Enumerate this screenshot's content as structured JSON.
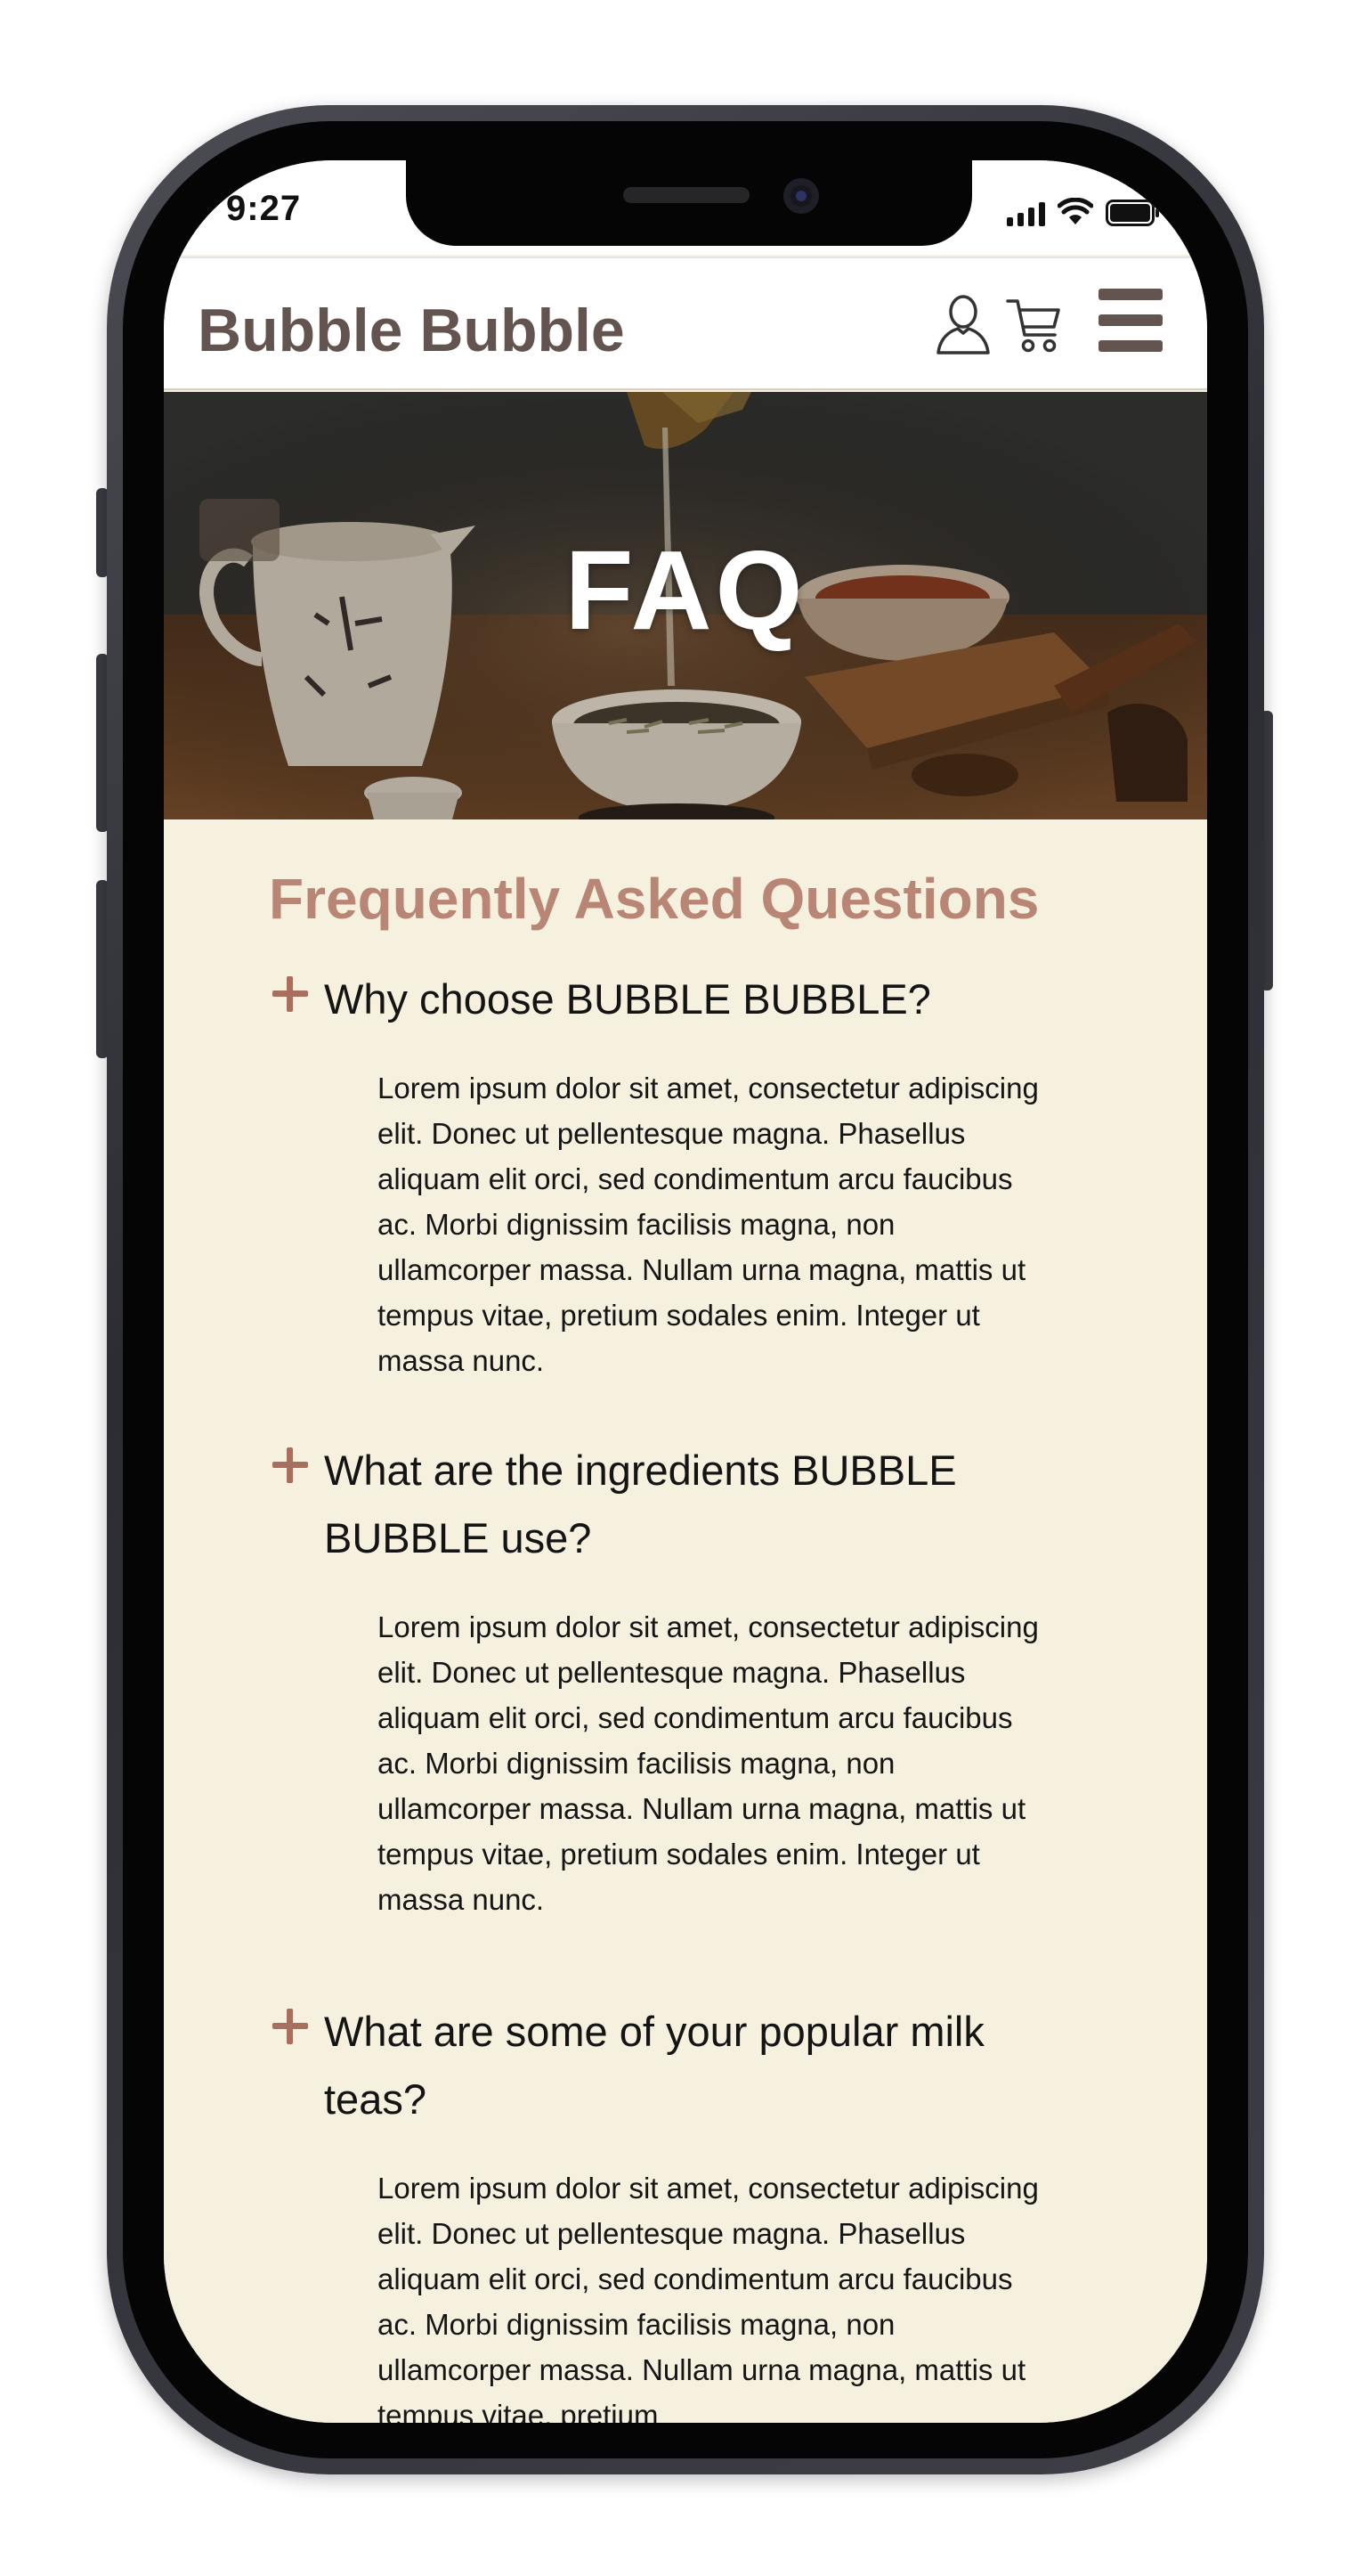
{
  "status_bar": {
    "time": "9:27",
    "icons": [
      "cellular-signal-icon",
      "wifi-icon",
      "battery-icon"
    ]
  },
  "header": {
    "brand": "Bubble Bubble",
    "icons": [
      "user-icon",
      "cart-icon",
      "hamburger-menu-icon"
    ]
  },
  "hero": {
    "title": "FAQ",
    "image": "tea-pouring-photo"
  },
  "faq": {
    "heading": "Frequently Asked Questions",
    "items": [
      {
        "question": "Why choose BUBBLE BUBBLE?",
        "answer": "Lorem ipsum dolor sit amet, consectetur adipiscing elit. Donec ut pellentesque magna. Phasellus aliquam elit orci, sed condimentum arcu faucibus ac. Morbi dignissim facilisis magna, non ullamcorper massa. Nullam urna magna, mattis ut tempus vitae, pretium sodales enim. Integer ut massa nunc."
      },
      {
        "question": "What are the ingredients BUBBLE BUBBLE use?",
        "answer": "Lorem ipsum dolor sit amet, consectetur adipiscing elit. Donec ut pellentesque magna. Phasellus aliquam elit orci, sed condimentum arcu faucibus ac. Morbi dignissim facilisis magna, non ullamcorper massa. Nullam urna magna, mattis ut tempus vitae, pretium sodales enim. Integer ut massa nunc."
      },
      {
        "question": "What are some of your popular milk teas?",
        "answer": "Lorem ipsum dolor sit amet, consectetur adipiscing elit. Donec ut pellentesque magna. Phasellus aliquam elit orci, sed condimentum arcu faucibus ac. Morbi dignissim facilisis magna, non ullamcorper massa. Nullam urna magna, mattis ut tempus vitae, pretium"
      }
    ]
  },
  "colors": {
    "brand_text": "#63544f",
    "accent": "#b98675",
    "plus_icon": "#a86e5e",
    "content_background": "#f6f0df",
    "header_background": "#ffffff"
  }
}
